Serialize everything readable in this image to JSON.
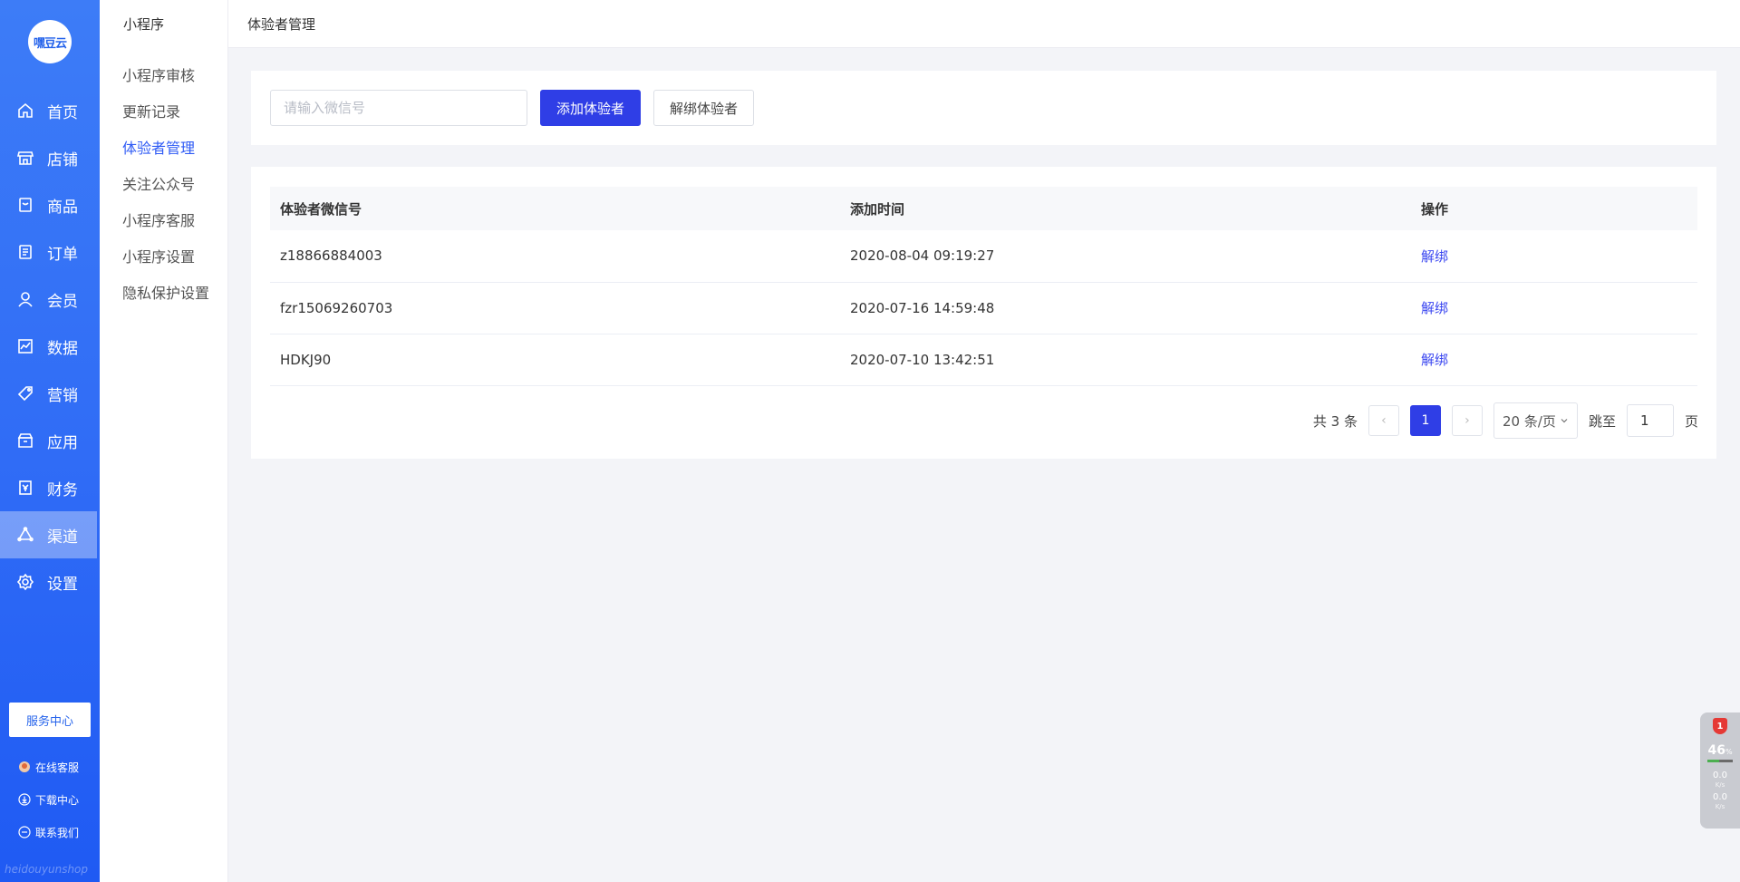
{
  "brand": {
    "logo_text": "嘿豆云",
    "footer_text": "heidouyunshop"
  },
  "sidebar": {
    "items": [
      {
        "label": "首页",
        "icon": "home-icon"
      },
      {
        "label": "店铺",
        "icon": "store-icon"
      },
      {
        "label": "商品",
        "icon": "product-icon"
      },
      {
        "label": "订单",
        "icon": "order-icon"
      },
      {
        "label": "会员",
        "icon": "member-icon"
      },
      {
        "label": "数据",
        "icon": "chart-icon"
      },
      {
        "label": "营销",
        "icon": "tag-icon"
      },
      {
        "label": "应用",
        "icon": "app-box-icon"
      },
      {
        "label": "财务",
        "icon": "finance-icon"
      },
      {
        "label": "渠道",
        "icon": "channel-icon",
        "active": true
      },
      {
        "label": "设置",
        "icon": "gear-icon"
      }
    ],
    "service_center": "服务中心",
    "bottom_links": [
      {
        "label": "在线客服",
        "icon": "customer-service-icon"
      },
      {
        "label": "下载中心",
        "icon": "download-icon"
      },
      {
        "label": "联系我们",
        "icon": "contact-icon"
      }
    ]
  },
  "subnav": {
    "title": "小程序",
    "items": [
      "小程序审核",
      "更新记录",
      "体验者管理",
      "关注公众号",
      "小程序客服",
      "小程序设置",
      "隐私保护设置"
    ],
    "active": "体验者管理"
  },
  "header": {
    "title": "体验者管理"
  },
  "toolbar": {
    "search_placeholder": "请输入微信号",
    "search_value": "",
    "add_label": "添加体验者",
    "unbind_label": "解绑体验者"
  },
  "table": {
    "headers": [
      "体验者微信号",
      "添加时间",
      "操作"
    ],
    "rows": [
      {
        "wechat": "z18866884003",
        "time": "2020-08-04 09:19:27",
        "action": "解绑"
      },
      {
        "wechat": "fzr15069260703",
        "time": "2020-07-16 14:59:48",
        "action": "解绑"
      },
      {
        "wechat": "HDKJ90",
        "time": "2020-07-10 13:42:51",
        "action": "解绑"
      }
    ]
  },
  "pager": {
    "total_text": "共 3 条",
    "current_page": "1",
    "page_size": "20 条/页",
    "jump_label": "跳至",
    "jump_value": "1",
    "page_suffix": "页"
  },
  "widget": {
    "badge": "1",
    "percent": "46",
    "percent_unit": "%",
    "percent_value": 46,
    "up_rate": "0.0",
    "down_rate": "0.0",
    "rate_unit": "K/s"
  }
}
